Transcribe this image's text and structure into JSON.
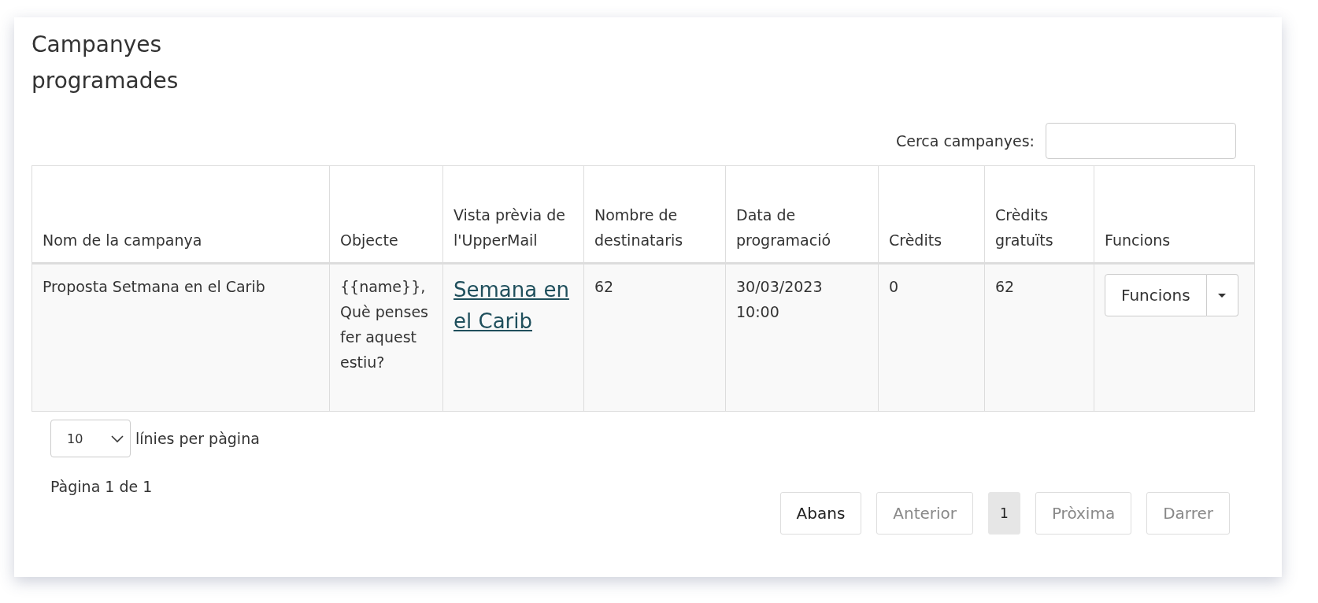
{
  "title": "Campanyes programades",
  "search": {
    "label": "Cerca campanyes:"
  },
  "table": {
    "columns": [
      "Nom de la campanya",
      "Objecte",
      "Vista prèvia de l'UpperMail",
      "Nombre de destinataris",
      "Data de programació",
      "Crèdits",
      "Crèdits gratuïts",
      "Funcions"
    ],
    "rows": [
      {
        "name": "Proposta Setmana en el Carib",
        "subject": "{{name}}, Què penses fer aquest estiu?",
        "preview": "Semana en el Carib",
        "recipients": "62",
        "date": "30/03/2023 10:00",
        "credits": "0",
        "free_credits": "62",
        "action": "Funcions"
      }
    ]
  },
  "page_size": {
    "value": "10",
    "label": "línies per pàgina"
  },
  "page_info": "Pàgina 1 de 1",
  "pager": [
    {
      "label": "Abans",
      "kind": "nav",
      "disabled": false
    },
    {
      "label": "Anterior",
      "kind": "nav",
      "disabled": true
    },
    {
      "label": "1",
      "kind": "page",
      "selected": true
    },
    {
      "label": "Pròxima",
      "kind": "nav",
      "disabled": true
    },
    {
      "label": "Darrer",
      "kind": "nav",
      "disabled": true
    }
  ]
}
